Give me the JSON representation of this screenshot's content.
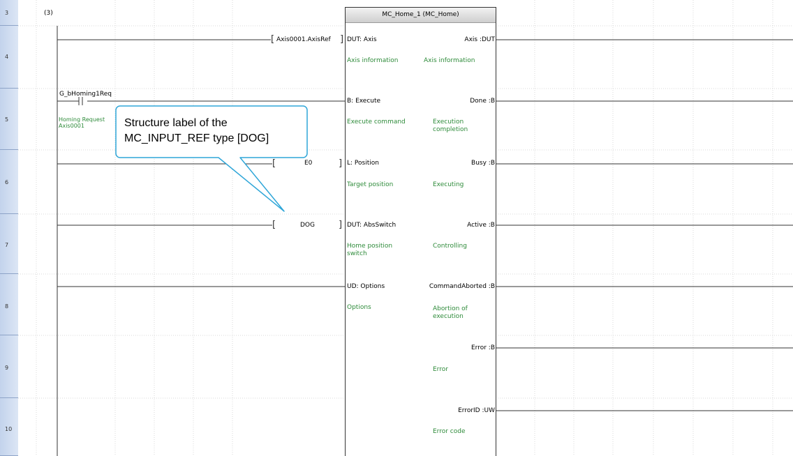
{
  "rungs": [
    {
      "num": "3",
      "label": "(3)"
    },
    {
      "num": "4"
    },
    {
      "num": "5"
    },
    {
      "num": "6"
    },
    {
      "num": "7"
    },
    {
      "num": "8"
    },
    {
      "num": "9"
    },
    {
      "num": "10"
    }
  ],
  "fb": {
    "title": "MC_Home_1 (MC_Home)",
    "inputs": [
      {
        "name": "DUT: Axis",
        "comment": "Axis information",
        "operand": "Axis0001.AxisRef"
      },
      {
        "name": "B: Execute",
        "comment": "Execute command",
        "operand": ""
      },
      {
        "name": "L: Position",
        "comment": "Target position",
        "operand": "E0"
      },
      {
        "name": "DUT: AbsSwitch",
        "comment": "Home position switch",
        "operand": "DOG"
      },
      {
        "name": "UD: Options",
        "comment": "Options",
        "operand": ""
      }
    ],
    "outputs": [
      {
        "name": "Axis :DUT",
        "comment": "Axis information"
      },
      {
        "name": "Done :B",
        "comment": "Execution completion"
      },
      {
        "name": "Busy :B",
        "comment": "Executing"
      },
      {
        "name": "Active :B",
        "comment": "Controlling"
      },
      {
        "name": "CommandAborted :B",
        "comment": "Abortion of execution"
      },
      {
        "name": "Error :B",
        "comment": "Error"
      },
      {
        "name": "ErrorID :UW",
        "comment": "Error code"
      }
    ]
  },
  "contact": {
    "label": "G_bHoming1Req",
    "comment": "Homing Request Axis0001"
  },
  "callout": {
    "line1": "Structure label of the",
    "line2": "MC_INPUT_REF type [DOG]"
  },
  "colors": {
    "gutter": "#cfdcef",
    "comment_green": "#2e8b3a",
    "callout_border": "#2fa6d8",
    "grid_dotted": "#d0d0d0"
  }
}
